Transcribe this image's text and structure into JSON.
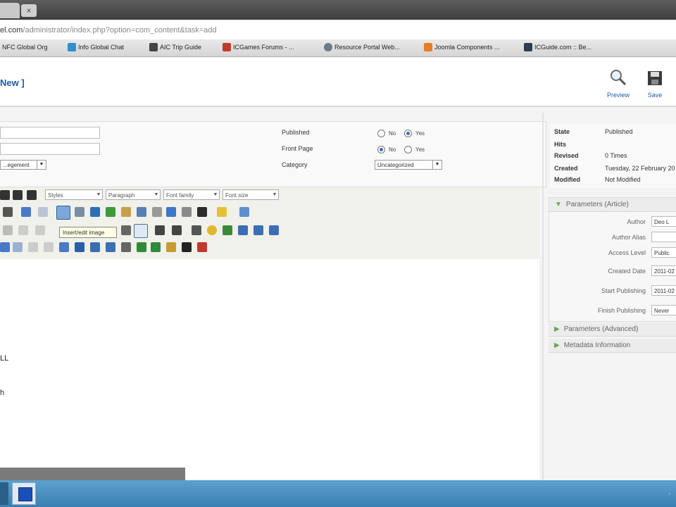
{
  "browser": {
    "tab_close": "×",
    "url_host": "el.com",
    "url_path": "/administrator/index.php?option=com_content&task=add"
  },
  "bookmarks": [
    {
      "label": "NFC Global Org",
      "color": "#3e7cc4"
    },
    {
      "label": "Info Global Chat",
      "color": "#2f8fd0"
    },
    {
      "label": "AIC Trip Guide",
      "color": "#444444"
    },
    {
      "label": "ICGames Forums - ...",
      "color": "#c0392b"
    },
    {
      "label": "Resource Portal Web...",
      "color": "#6c7a89"
    },
    {
      "label": "Joomla Components ...",
      "color": "#e67e22"
    },
    {
      "label": "ICGuide.com :: Be...",
      "color": "#2c3e50"
    }
  ],
  "header": {
    "title": "New ]",
    "preview_label": "Preview",
    "save_label": "Save"
  },
  "details": {
    "section_select": "...egement",
    "published_label": "Published",
    "frontpage_label": "Front Page",
    "category_label": "Category",
    "no_label": "No",
    "yes_label": "Yes",
    "category_value": "Uncategorized",
    "published_value": "Yes",
    "frontpage_value": "No"
  },
  "editor": {
    "styles_select": "Styles",
    "paragraph_select": "Paragraph",
    "font_family_select": "Font family",
    "font_size_select": "Font size",
    "tooltip": "Insert/edit image",
    "content_line1": "LL",
    "content_line2": "h"
  },
  "info": {
    "rows": [
      {
        "label": "State",
        "value": "Published"
      },
      {
        "label": "Hits",
        "value": ""
      },
      {
        "label": "Revised",
        "value": "0 Times"
      },
      {
        "label": "Created",
        "value": "Tuesday, 22 February 20"
      },
      {
        "label": "Modified",
        "value": "Not Modified"
      }
    ]
  },
  "parameters": {
    "article_header": "Parameters (Article)",
    "fields": [
      {
        "label": "Author",
        "value": "Deo L"
      },
      {
        "label": "Author Alias",
        "value": ""
      },
      {
        "label": "Access Level",
        "value": "Public"
      },
      {
        "label": "Created Date",
        "value": "2011-02"
      },
      {
        "label": "Start Publishing",
        "value": "2011-02"
      },
      {
        "label": "Finish Publishing",
        "value": "Never"
      }
    ],
    "advanced_header": "Parameters (Advanced)",
    "metadata_header": "Metadata Information"
  },
  "taskbar": {
    "tray": "."
  }
}
